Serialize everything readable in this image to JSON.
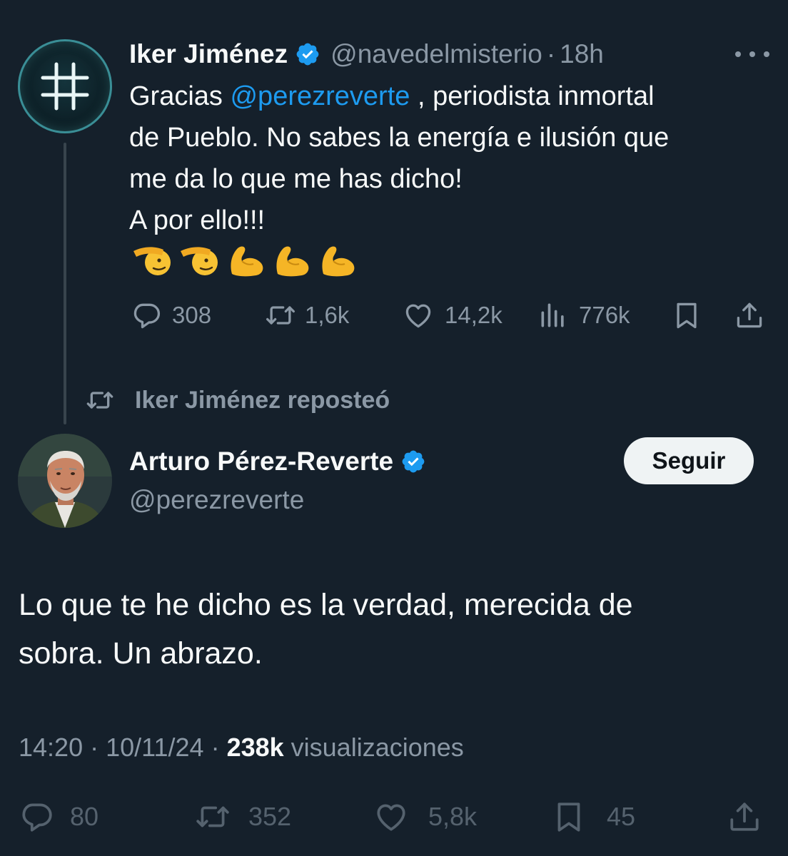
{
  "top_tweet": {
    "author_name": "Iker Jiménez",
    "handle": "@navedelmisterio",
    "separator": "·",
    "time": "18h",
    "text_prefix": "Gracias ",
    "mention": "@perezreverte",
    "text_line1_rest": " , periodista inmortal",
    "text_line2": "de Pueblo. No sabes la energía e ilusión que",
    "text_line3": "me da lo que me has dicho!",
    "text_line4": "A por ello!!!",
    "emojis": [
      "🫡",
      "🫡",
      "💪",
      "💪",
      "💪"
    ],
    "actions": {
      "replies": "308",
      "reposts": "1,6k",
      "likes": "14,2k",
      "views": "776k"
    }
  },
  "repost_label": "Iker Jiménez reposteó",
  "quoted_tweet": {
    "author_name": "Arturo Pérez-Reverte",
    "handle": "@perezreverte",
    "follow_label": "Seguir",
    "text_line1": "Lo que te he dicho es la verdad, merecida de",
    "text_line2": "sobra. Un abrazo.",
    "time": "14:20",
    "date": "10/11/24",
    "views_count": "238k",
    "views_label": "visualizaciones",
    "separator": "·",
    "actions": {
      "replies": "80",
      "reposts": "352",
      "likes": "5,8k",
      "bookmarks": "45"
    }
  },
  "colors": {
    "background": "#15202b",
    "text": "#f7f9f9",
    "muted": "#8b98a5",
    "accent": "#1d9bf0",
    "thread_line": "#38444d"
  }
}
